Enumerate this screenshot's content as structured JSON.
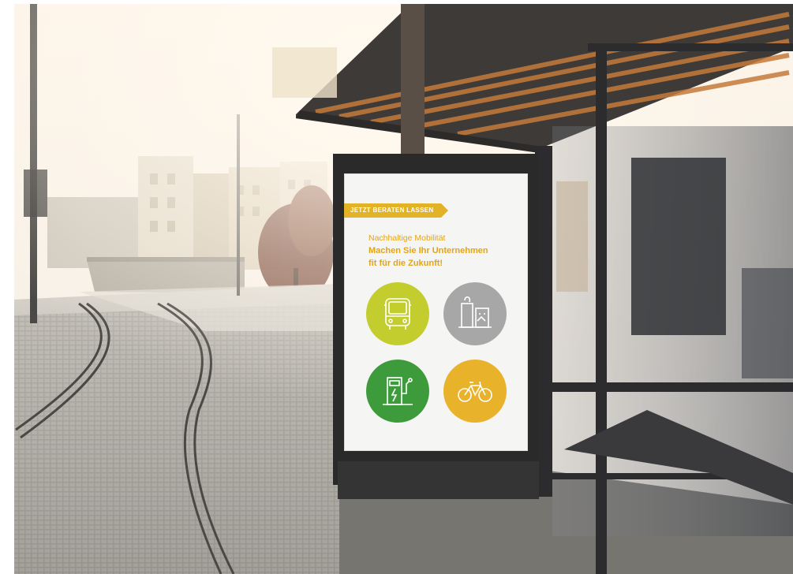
{
  "poster": {
    "tag": "JETZT BERATEN LASSEN",
    "subtitle": "Nachhaltige Mobilität",
    "headline_line1": "Machen Sie Ihr Unternehmen",
    "headline_line2": "fit für die Zukunft!"
  },
  "icons": [
    {
      "name": "bus-icon",
      "color": "#c3cd2e"
    },
    {
      "name": "city-buildings-icon",
      "color": "#a7a7a7"
    },
    {
      "name": "ev-charging-station-icon",
      "color": "#3e9b3b"
    },
    {
      "name": "bicycle-icon",
      "color": "#e8b22a"
    }
  ],
  "colors": {
    "accent": "#e2a51a",
    "tag_background": "#e2b227"
  }
}
